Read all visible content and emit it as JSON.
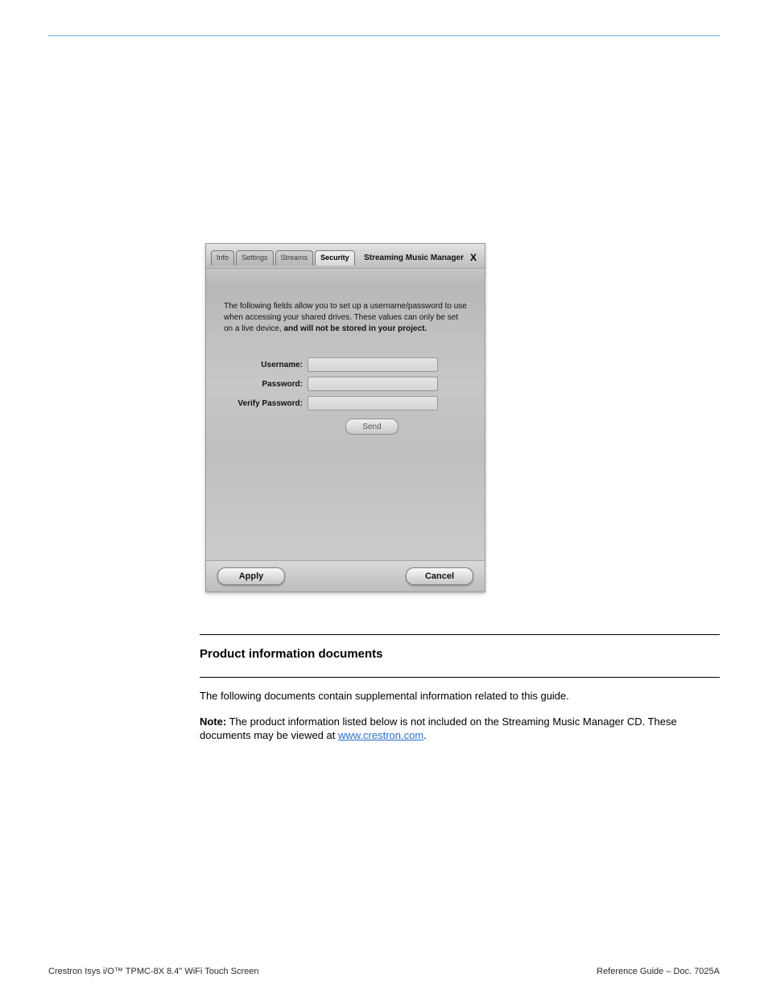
{
  "dialog": {
    "title": "Streaming Music Manager",
    "close_glyph": "X",
    "tabs": {
      "info": "Info",
      "settings": "Settings",
      "streams": "Streams",
      "security": "Security"
    },
    "description": "The following fields allow you to set up a username/password to use when accessing your shared drives. These values can only be set on a live device, ",
    "description_bold": "and will not be stored in your project.",
    "fields": {
      "username_label": "Username:",
      "password_label": "Password:",
      "verify_label": "Verify Password:",
      "username_value": "",
      "password_value": "",
      "verify_value": ""
    },
    "buttons": {
      "send": "Send",
      "apply": "Apply",
      "cancel": "Cancel"
    }
  },
  "body": {
    "rule_spacer": " ",
    "section_title": "Product information documents",
    "p1": "The following documents contain supplemental information related to this guide.",
    "note_label": "Note:",
    "note_body": " The product information listed below is not included on the Streaming Music Manager CD. These documents may be viewed at ",
    "note_link_text": "www.crestron.com",
    "note_tail": "."
  },
  "footer": {
    "left": "Crestron Isys i/O™ TPMC-8X 8.4\" WiFi Touch Screen",
    "right": "Reference Guide – Doc. 7025A"
  }
}
